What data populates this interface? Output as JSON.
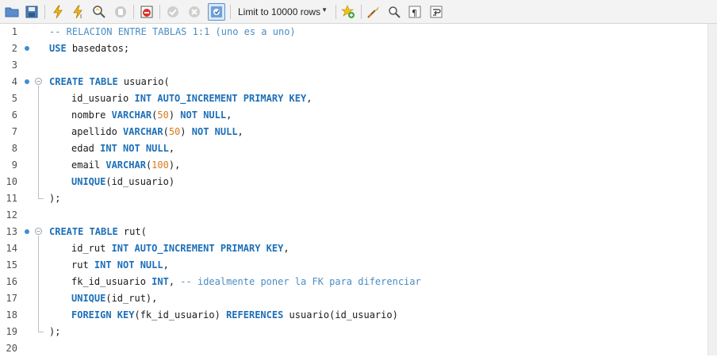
{
  "toolbar": {
    "buttons": [
      {
        "name": "open-file-icon"
      },
      {
        "name": "save-icon"
      },
      {
        "name": "execute-icon"
      },
      {
        "name": "execute-current-icon"
      },
      {
        "name": "explain-icon"
      },
      {
        "name": "stop-icon"
      },
      {
        "name": "toggle-error-stop-icon"
      },
      {
        "name": "commit-icon"
      },
      {
        "name": "rollback-icon"
      },
      {
        "name": "autocommit-icon"
      }
    ],
    "limit_label": "Limit to 10000 rows",
    "right_buttons": [
      {
        "name": "add-snippet-icon"
      },
      {
        "name": "beautify-icon"
      },
      {
        "name": "find-icon"
      },
      {
        "name": "invisible-chars-icon"
      },
      {
        "name": "word-wrap-icon"
      }
    ]
  },
  "editor": {
    "lines": [
      {
        "n": "1",
        "tokens": [
          {
            "t": "cm",
            "v": "-- RELACION ENTRE TABLAS 1:1 (uno es a uno)"
          }
        ]
      },
      {
        "n": "2",
        "dot": true,
        "tokens": [
          {
            "t": "kw",
            "v": "USE"
          },
          {
            "t": "pl",
            "v": " basedatos;"
          }
        ]
      },
      {
        "n": "3",
        "tokens": []
      },
      {
        "n": "4",
        "dot": true,
        "fold": "start",
        "tokens": [
          {
            "t": "kw",
            "v": "CREATE TABLE"
          },
          {
            "t": "pl",
            "v": " usuario("
          }
        ]
      },
      {
        "n": "5",
        "indent": true,
        "tokens": [
          {
            "t": "pl",
            "v": "id_usuario "
          },
          {
            "t": "kw",
            "v": "INT AUTO_INCREMENT PRIMARY KEY"
          },
          {
            "t": "pl",
            "v": ","
          }
        ]
      },
      {
        "n": "6",
        "indent": true,
        "tokens": [
          {
            "t": "pl",
            "v": "nombre "
          },
          {
            "t": "kw",
            "v": "VARCHAR"
          },
          {
            "t": "pl",
            "v": "("
          },
          {
            "t": "num",
            "v": "50"
          },
          {
            "t": "pl",
            "v": ") "
          },
          {
            "t": "kw",
            "v": "NOT NULL"
          },
          {
            "t": "pl",
            "v": ","
          }
        ]
      },
      {
        "n": "7",
        "indent": true,
        "tokens": [
          {
            "t": "pl",
            "v": "apellido "
          },
          {
            "t": "kw",
            "v": "VARCHAR"
          },
          {
            "t": "pl",
            "v": "("
          },
          {
            "t": "num",
            "v": "50"
          },
          {
            "t": "pl",
            "v": ") "
          },
          {
            "t": "kw",
            "v": "NOT NULL"
          },
          {
            "t": "pl",
            "v": ","
          }
        ]
      },
      {
        "n": "8",
        "indent": true,
        "tokens": [
          {
            "t": "pl",
            "v": "edad "
          },
          {
            "t": "kw",
            "v": "INT NOT NULL"
          },
          {
            "t": "pl",
            "v": ","
          }
        ]
      },
      {
        "n": "9",
        "indent": true,
        "tokens": [
          {
            "t": "pl",
            "v": "email "
          },
          {
            "t": "kw",
            "v": "VARCHAR"
          },
          {
            "t": "pl",
            "v": "("
          },
          {
            "t": "num",
            "v": "100"
          },
          {
            "t": "pl",
            "v": "),"
          }
        ]
      },
      {
        "n": "10",
        "indent": true,
        "tokens": [
          {
            "t": "kw",
            "v": "UNIQUE"
          },
          {
            "t": "pl",
            "v": "(id_usuario)"
          }
        ]
      },
      {
        "n": "11",
        "fold": "end",
        "tokens": [
          {
            "t": "pl",
            "v": ");"
          }
        ]
      },
      {
        "n": "12",
        "tokens": []
      },
      {
        "n": "13",
        "dot": true,
        "fold": "start",
        "tokens": [
          {
            "t": "kw",
            "v": "CREATE TABLE"
          },
          {
            "t": "pl",
            "v": " rut("
          }
        ]
      },
      {
        "n": "14",
        "indent": true,
        "tokens": [
          {
            "t": "pl",
            "v": "id_rut "
          },
          {
            "t": "kw",
            "v": "INT AUTO_INCREMENT PRIMARY KEY"
          },
          {
            "t": "pl",
            "v": ","
          }
        ]
      },
      {
        "n": "15",
        "indent": true,
        "tokens": [
          {
            "t": "pl",
            "v": "rut "
          },
          {
            "t": "kw",
            "v": "INT NOT NULL"
          },
          {
            "t": "pl",
            "v": ","
          }
        ]
      },
      {
        "n": "16",
        "indent": true,
        "tokens": [
          {
            "t": "pl",
            "v": "fk_id_usuario "
          },
          {
            "t": "kw",
            "v": "INT"
          },
          {
            "t": "pl",
            "v": ", "
          },
          {
            "t": "cm",
            "v": "-- idealmente poner la FK para diferenciar"
          }
        ]
      },
      {
        "n": "17",
        "indent": true,
        "tokens": [
          {
            "t": "kw",
            "v": "UNIQUE"
          },
          {
            "t": "pl",
            "v": "(id_rut),"
          }
        ]
      },
      {
        "n": "18",
        "indent": true,
        "tokens": [
          {
            "t": "kw",
            "v": "FOREIGN KEY"
          },
          {
            "t": "pl",
            "v": "(fk_id_usuario) "
          },
          {
            "t": "kw",
            "v": "REFERENCES"
          },
          {
            "t": "pl",
            "v": " usuario(id_usuario)"
          }
        ]
      },
      {
        "n": "19",
        "fold": "end",
        "tokens": [
          {
            "t": "pl",
            "v": ");"
          }
        ]
      },
      {
        "n": "20",
        "tokens": []
      }
    ]
  },
  "colors": {
    "keyword": "#1d6fb8",
    "comment": "#4a8ec5",
    "number": "#d97a1c",
    "statement_marker": "#3c8fd6"
  }
}
